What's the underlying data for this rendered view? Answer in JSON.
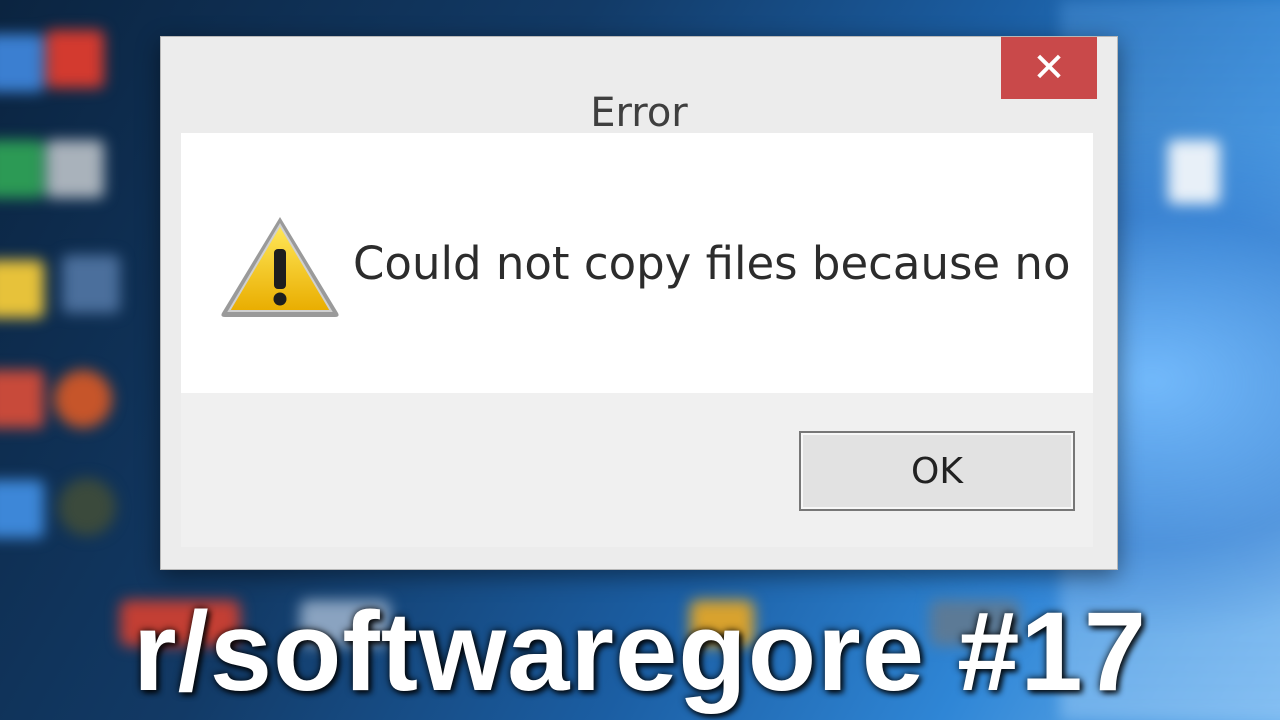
{
  "dialog": {
    "title": "Error",
    "close_glyph": "✕",
    "close_icon": "close-icon",
    "warning_icon": "warning-triangle-icon",
    "message": "Could not copy files because no",
    "ok_label": "OK",
    "colors": {
      "close_button": "#c9494a",
      "dialog_bg": "#ececec",
      "content_bg": "#ffffff"
    }
  },
  "overlay": {
    "caption": "r/softwaregore #17"
  }
}
